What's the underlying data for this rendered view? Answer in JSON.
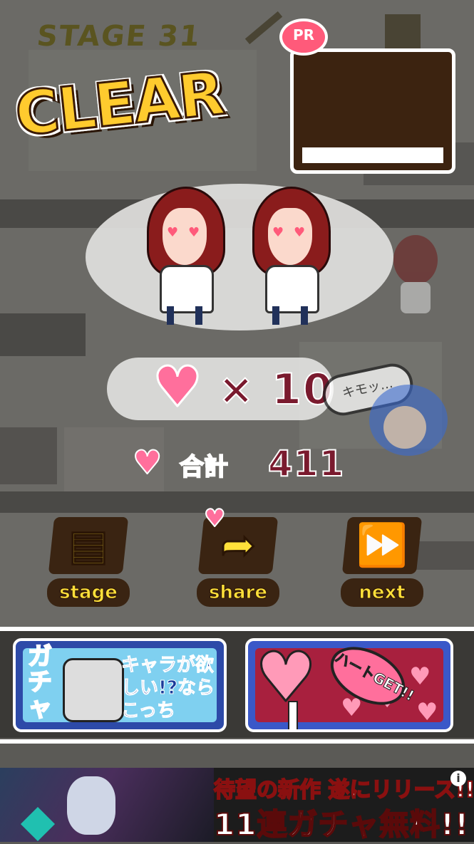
{
  "stage": {
    "title": "STAGE 31"
  },
  "result": {
    "clear_text": "CLEAR"
  },
  "ad_top": {
    "badge": "PR"
  },
  "score": {
    "multiplier": "× 10",
    "total_label": "合計",
    "total_value": "411"
  },
  "bubble": {
    "text": "キモッ…"
  },
  "menu": {
    "stage_label": "stage",
    "share_label": "share",
    "next_label": "next",
    "stage_icon": "stage-panel-icon",
    "share_icon": "share-arrow-icon",
    "next_icon": "fast-forward-icon"
  },
  "banners": {
    "gacha_vertical": "ガチャ",
    "gacha_copy": "キャラが欲しい!?ならこっち",
    "heart_get": "ハートGET!!"
  },
  "ad_bottom": {
    "line1": "待望の新作 遂にリリース!!",
    "line2": "11連ガチャ無料!!",
    "info": "i"
  },
  "colors": {
    "heart": "#ff6f9c",
    "score_text": "#7a1a2e",
    "button_yellow": "#ffe03a",
    "clear_yellow": "#ffcb2e"
  }
}
